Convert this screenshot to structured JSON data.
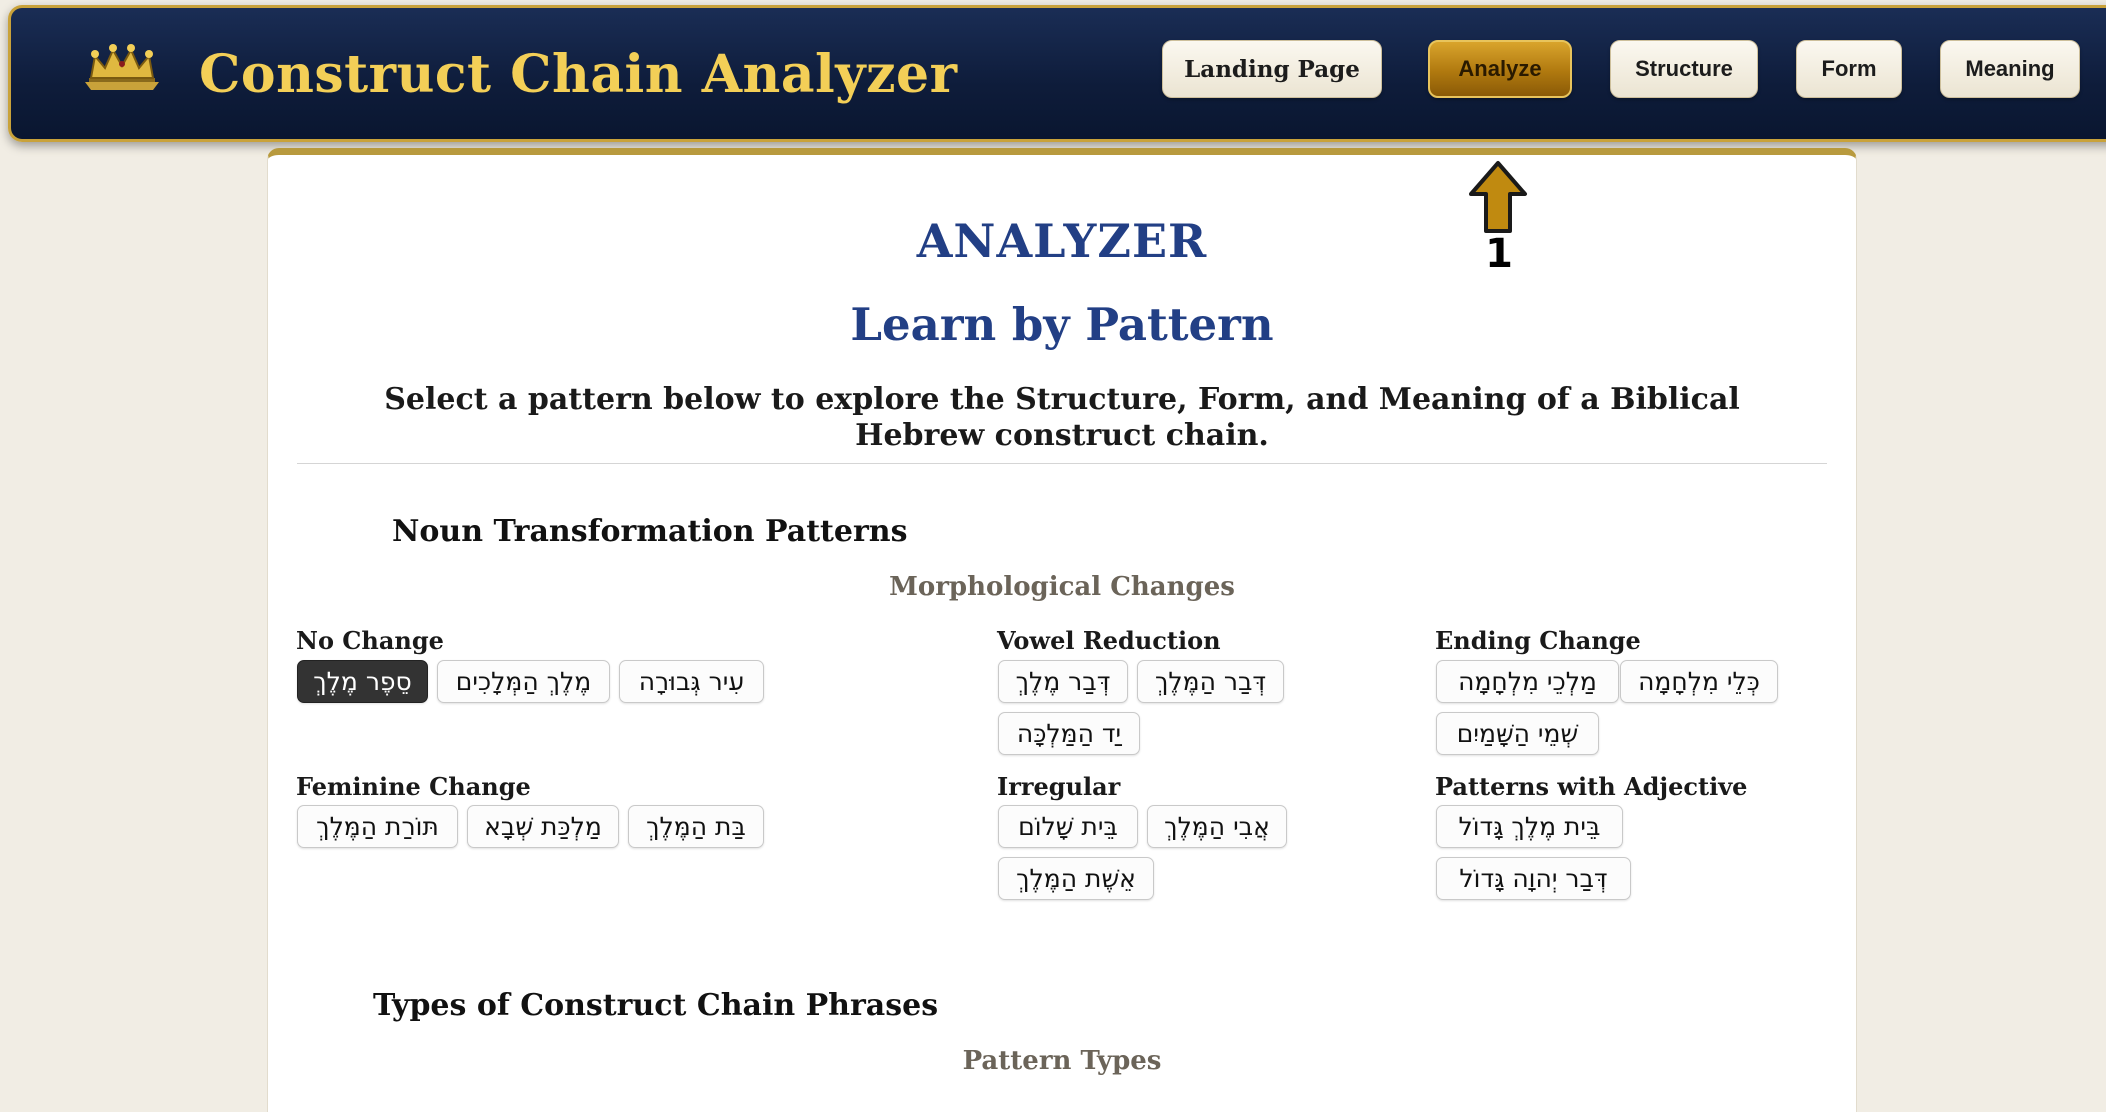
{
  "header": {
    "app_title": "Construct Chain Analyzer",
    "logo_icon": "crown-icon",
    "nav": {
      "landing": "Landing Page",
      "analyze": "Analyze",
      "structure": "Structure",
      "form": "Form",
      "meaning": "Meaning"
    },
    "active_nav": "Analyze"
  },
  "annotation": {
    "marker": "1",
    "icon": "up-arrow-icon",
    "color": "#c08a10"
  },
  "main": {
    "title": "ANALYZER",
    "subtitle": "Learn by Pattern",
    "intro": "Select a pattern below to explore the Structure, Form, and Meaning of a Biblical Hebrew construct chain.",
    "noun_section": {
      "title": "Noun Transformation Patterns",
      "subtitle": "Morphological Changes",
      "groups": {
        "no_change": {
          "label": "No Change",
          "items": [
            "סֵפֶר מֶלֶךְ",
            "מֶלֶךְ הַמְּלָכִים",
            "עִיר גְּבוּרָה"
          ]
        },
        "vowel_reduction": {
          "label": "Vowel Reduction",
          "items": [
            "דְּבַר מֶלֶךְ",
            "דְּבַר הַמֶּלֶךְ",
            "יַד הַמַּלְכָּה"
          ]
        },
        "ending_change": {
          "label": "Ending Change",
          "items": [
            "מַלְכֵי מִלְחָמָה",
            "כְּלֵי מִלְחָמָה",
            "שְׁמֵי הַשָּׁמַיִם"
          ]
        },
        "feminine_change": {
          "label": "Feminine Change",
          "items": [
            "תּוֹרַת הַמֶּלֶךְ",
            "מַלְכַּת שְׁבָא",
            "בַּת הַמֶּלֶךְ"
          ]
        },
        "irregular": {
          "label": "Irregular",
          "items": [
            "בֵּית שָׁלוֹם",
            "אֲבִי הַמֶּלֶךְ",
            "אֵשֶׁת הַמֶּלֶךְ"
          ]
        },
        "adjective": {
          "label": "Patterns with Adjective",
          "items": [
            "בֵּית מֶלֶךְ גָּדוֹל",
            "דְּבַר יְהוָה גָּדוֹל"
          ]
        }
      },
      "selected": "סֵפֶר מֶלֶךְ"
    },
    "types_section": {
      "title": "Types of Construct Chain Phrases",
      "subtitle": "Pattern Types"
    }
  },
  "colors": {
    "header_bg": "#0e1c3a",
    "title_gold": "#f3cf57",
    "accent_gold": "#c9a23a",
    "heading_blue": "#223f85",
    "active_button": "#b0790f"
  }
}
